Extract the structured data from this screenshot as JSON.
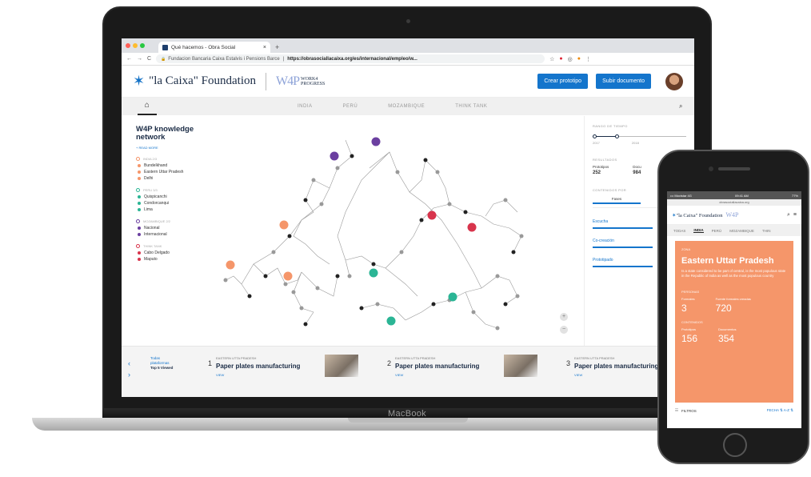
{
  "browser": {
    "tab_title": "Qué hacemos - Obra Social",
    "tab_close": "×",
    "new_tab": "+",
    "nav_back": "←",
    "nav_forward": "→",
    "nav_reload": "C",
    "url_site": "Fundacion Bancaria Caixa Estalvis i Pensions Barce",
    "url_path": "https://obrasociallacaixa.org/es/internacional/empleo/w...",
    "lock": "🔒"
  },
  "site": {
    "logo_text": "\"la Caixa\" Foundation",
    "w4p_text": "W4P",
    "w4p_sub": "WORK4 PROGRESS",
    "btn_create": "Crear prototipo",
    "btn_upload": "Subir documento",
    "nav": [
      "INDIA",
      "PERÚ",
      "MOZAMBIQUE",
      "THINK TANK"
    ],
    "home_icon": "⌂",
    "search_icon": "⌕"
  },
  "sidebar": {
    "title": "W4P knowledge network",
    "read_more": "+ READ MORE",
    "groups": [
      {
        "header": "INDIA 2/3",
        "color": "#f5966a",
        "items": [
          "Bundelkhand",
          "Eastern Uttar Pradesh",
          "Delhi"
        ]
      },
      {
        "header": "PERU 3/3",
        "color": "#2bb595",
        "items": [
          "Quispicanchi",
          "Condorcanqui",
          "Lima"
        ]
      },
      {
        "header": "MOZAMBIQUE 2/2",
        "color": "#6b3fa0",
        "items": [
          "Nacional",
          "Internacional"
        ]
      },
      {
        "header": "THINK TANK",
        "color": "#d8344c",
        "items": [
          "Cabo Delgado",
          "Maputo"
        ]
      }
    ]
  },
  "panel": {
    "time_label": "RANGO DE TIEMPO",
    "years": [
      "2017",
      "2018"
    ],
    "results_label": "RESULTADOS",
    "results": [
      {
        "k": "Prototipos",
        "v": "252"
      },
      {
        "k": "Docu",
        "v": "984"
      }
    ],
    "contents_label": "CONTENIDOS POR",
    "subtabs": [
      "Fases",
      "Sub"
    ],
    "filters": [
      "Escucha",
      "Co-creación",
      "Prototipado"
    ],
    "zoom_in": "+",
    "zoom_out": "−"
  },
  "bottom": {
    "arrow_prev": "‹",
    "arrow_next": "›",
    "top5_a": "Todas plataformas",
    "top5_b": "Top 5 Viewed",
    "cards": [
      {
        "n": "1",
        "sub": "EASTERN UTTA PRADESH",
        "title": "Paper plates manufacturing",
        "view": "VIEW"
      },
      {
        "n": "2",
        "sub": "EASTERN UTTA PRADESH",
        "title": "Paper plates manufacturing",
        "view": "VIEW"
      },
      {
        "n": "3",
        "sub": "EASTERN UTTA PRADESH",
        "title": "Paper plates manufacturing",
        "view": "VIEW"
      }
    ]
  },
  "laptop_label": "MacBook",
  "phone": {
    "status_left": "••• Movistar 4G",
    "status_mid": "09:41 AM",
    "status_right": "77%",
    "url": "obrasociallacaixa.org",
    "logo": "\"la Caixa\" Foundation",
    "w4p": "W4P",
    "nav": [
      "TODAS",
      "INDIA",
      "PERÚ",
      "MOZAMBIQUE",
      "THIN"
    ],
    "zone_label": "ZONA",
    "zone_title": "Eastern Uttar Pradesh",
    "zone_desc": "Is a state considered to be part of central, is the most populous state in the Republic of India as well as the most populous country",
    "people_label": "PERSONAS",
    "people": [
      {
        "k": "Formales",
        "v": "3"
      },
      {
        "k": "Fuente formales creadas",
        "v": "720"
      }
    ],
    "content_label": "CONTENIDOS",
    "content": [
      {
        "k": "Prototipos",
        "v": "156"
      },
      {
        "k": "Documentos",
        "v": "354"
      }
    ],
    "filter_label": "FILTROS",
    "filter_right": "FECHA ⇅   A-Z ⇅"
  },
  "colors": {
    "india": "#f5966a",
    "peru": "#2bb595",
    "mozambique": "#6b3fa0",
    "thinktank": "#d8344c",
    "accent": "#1475cc"
  }
}
